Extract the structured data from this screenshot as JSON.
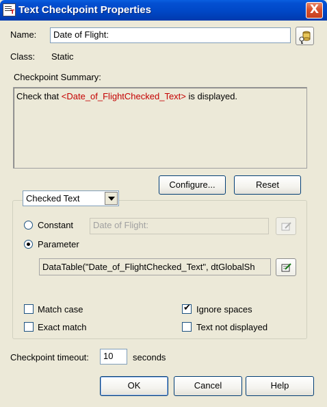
{
  "window": {
    "title": "Text Checkpoint Properties",
    "icon": "text-checkpoint-app-icon",
    "close_label": "X"
  },
  "name_field": {
    "label": "Name:",
    "value": "Date of Flight:"
  },
  "class_row": {
    "label": "Class:",
    "value": "Static"
  },
  "summary": {
    "label": "Checkpoint Summary:",
    "text_before": "Check that ",
    "param_text": "<Date_of_FlightChecked_Text>",
    "text_after": " is displayed."
  },
  "buttons": {
    "configure": "Configure...",
    "reset": "Reset",
    "ok": "OK",
    "cancel": "Cancel",
    "help": "Help"
  },
  "text_selector": {
    "selected": "Checked Text"
  },
  "value_options": {
    "constant_label": "Constant",
    "constant_value": "Date of Flight:",
    "parameter_label": "Parameter",
    "parameter_value": "DataTable(\"Date_of_FlightChecked_Text\", dtGlobalSh",
    "selected": "Parameter"
  },
  "options": {
    "match_case": {
      "label": "Match case",
      "checked": false
    },
    "ignore_spaces": {
      "label": "Ignore spaces",
      "checked": true
    },
    "exact_match": {
      "label": "Exact match",
      "checked": false
    },
    "text_not_displayed": {
      "label": "Text not displayed",
      "checked": false
    }
  },
  "timeout": {
    "label": "Checkpoint timeout:",
    "value": "10",
    "unit": "seconds"
  },
  "colors": {
    "titlebar": "#0450d2",
    "dialog_bg": "#ece9d8",
    "param_red": "#c40000",
    "close_red": "#d8512d"
  }
}
